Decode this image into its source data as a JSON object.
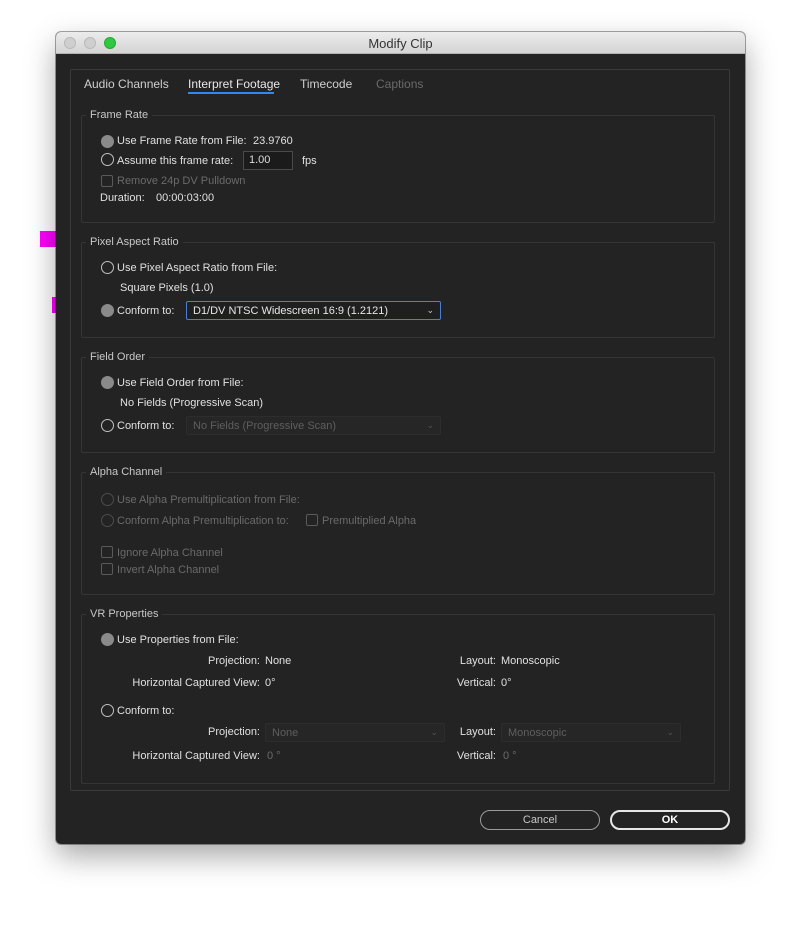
{
  "window": {
    "title": "Modify Clip"
  },
  "tabs": [
    {
      "label": "Audio Channels"
    },
    {
      "label": "Interpret Footage"
    },
    {
      "label": "Timecode"
    },
    {
      "label": "Captions"
    }
  ],
  "frame_rate": {
    "title": "Frame Rate",
    "use_from_file_label": "Use Frame Rate from File:",
    "file_value": "23.9760",
    "assume_label": "Assume this frame rate:",
    "assume_value": "1.00",
    "fps_label": "fps",
    "pulldown_label": "Remove 24p DV Pulldown",
    "duration_label": "Duration:",
    "duration_value": "00:00:03:00"
  },
  "pixel_aspect": {
    "title": "Pixel Aspect Ratio",
    "use_from_file_label": "Use Pixel Aspect Ratio from File:",
    "file_value": "Square Pixels (1.0)",
    "conform_label": "Conform to:",
    "conform_value": "D1/DV NTSC Widescreen 16:9 (1.2121)"
  },
  "field_order": {
    "title": "Field Order",
    "use_from_file_label": "Use Field Order from File:",
    "file_value": "No Fields (Progressive Scan)",
    "conform_label": "Conform to:",
    "conform_value": "No Fields (Progressive Scan)"
  },
  "alpha": {
    "title": "Alpha Channel",
    "use_from_file_label": "Use Alpha Premultiplication from File:",
    "conform_label": "Conform Alpha Premultiplication to:",
    "premult_label": "Premultiplied Alpha",
    "ignore_label": "Ignore Alpha Channel",
    "invert_label": "Invert Alpha Channel"
  },
  "vr": {
    "title": "VR Properties",
    "use_from_file_label": "Use Properties from File:",
    "projection_label": "Projection:",
    "projection_value": "None",
    "layout_label": "Layout:",
    "layout_value": "Monoscopic",
    "hcv_label": "Horizontal Captured View:",
    "hcv_value": "0°",
    "vertical_label": "Vertical:",
    "vertical_value": "0°",
    "conform_label": "Conform to:",
    "conform_projection": "None",
    "conform_layout": "Monoscopic",
    "conform_hcv": "0 °",
    "conform_vertical": "0 °"
  },
  "buttons": {
    "cancel": "Cancel",
    "ok": "OK"
  },
  "colors": {
    "accent": "#2d8ceb",
    "annotation_arrow": "#ff00ff",
    "window_bg": "#232323"
  }
}
